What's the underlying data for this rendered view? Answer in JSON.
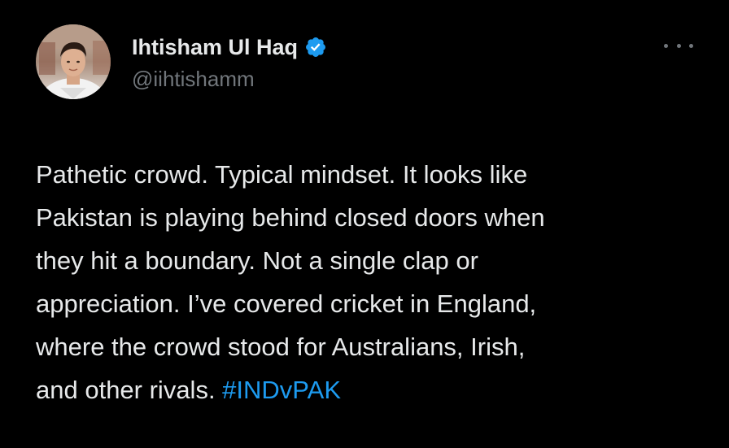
{
  "author": {
    "display_name": "Ihtisham Ul Haq",
    "handle": "@iihtishamm",
    "verified": true,
    "avatar_icon": "profile-photo"
  },
  "actions": {
    "more_icon": "more-horizontal-icon"
  },
  "tweet": {
    "lines": [
      "Pathetic crowd. Typical mindset. It looks like",
      "Pakistan is playing behind closed doors when",
      "they hit a boundary. Not a single clap or",
      "appreciation. I’ve covered cricket in England,",
      "where the crowd stood for Australians, Irish,"
    ],
    "last_line_text": "and other rivals. ",
    "hashtag": "#INDvPAK"
  },
  "colors": {
    "background": "#000000",
    "text": "#e7e9ea",
    "secondary": "#71767b",
    "accent": "#1d9bf0"
  }
}
